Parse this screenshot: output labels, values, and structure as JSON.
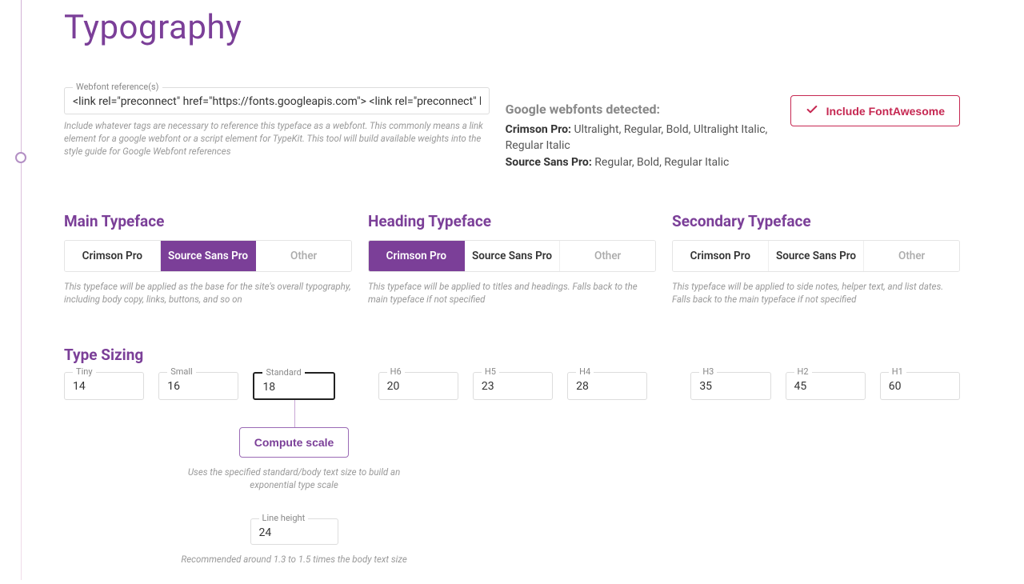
{
  "title": "Typography",
  "webfont": {
    "label": "Webfont reference(s)",
    "value": "<link rel=\"preconnect\" href=\"https://fonts.googleapis.com\"> <link rel=\"preconnect\" href=\"http",
    "help": "Include whatever tags are necessary to reference this typeface as a webfont. This commonly means a link element for a google webfont or a script element for TypeKit. This tool will build available weights into the style guide for Google Webfont references"
  },
  "detected": {
    "title": "Google webfonts detected:",
    "families": [
      {
        "name": "Crimson Pro:",
        "weights": "Ultralight, Regular, Bold, Ultralight Italic, Regular Italic"
      },
      {
        "name": "Source Sans Pro:",
        "weights": "Regular, Bold, Regular Italic"
      }
    ]
  },
  "fontawesome": {
    "label": "Include FontAwesome"
  },
  "typefaces": {
    "main": {
      "title": "Main Typeface",
      "options": [
        "Crimson Pro",
        "Source Sans Pro",
        "Other"
      ],
      "selected": 1,
      "help": "This typeface will be applied as the base for the site's overall typography, including body copy, links, buttons, and so on"
    },
    "heading": {
      "title": "Heading Typeface",
      "options": [
        "Crimson Pro",
        "Source Sans Pro",
        "Other"
      ],
      "selected": 0,
      "help": "This typeface will be applied to titles and headings. Falls back to the main typeface if not specified"
    },
    "secondary": {
      "title": "Secondary Typeface",
      "options": [
        "Crimson Pro",
        "Source Sans Pro",
        "Other"
      ],
      "selected": -1,
      "help": "This typeface will be applied to side notes, helper text, and list dates. Falls back to the main typeface if not specified"
    }
  },
  "sizing": {
    "title": "Type Sizing",
    "fields": [
      {
        "label": "Tiny",
        "value": "14"
      },
      {
        "label": "Small",
        "value": "16"
      },
      {
        "label": "Standard",
        "value": "18",
        "highlight": true
      },
      {
        "label": "H6",
        "value": "20"
      },
      {
        "label": "H5",
        "value": "23"
      },
      {
        "label": "H4",
        "value": "28"
      },
      {
        "label": "H3",
        "value": "35"
      },
      {
        "label": "H2",
        "value": "45"
      },
      {
        "label": "H1",
        "value": "60"
      }
    ],
    "compute_label": "Compute scale",
    "compute_help": "Uses the specified standard/body text size to build an exponential type scale",
    "lineheight": {
      "label": "Line height",
      "value": "24"
    },
    "lh_help": "Recommended around 1.3 to 1.5 times the body text size"
  }
}
